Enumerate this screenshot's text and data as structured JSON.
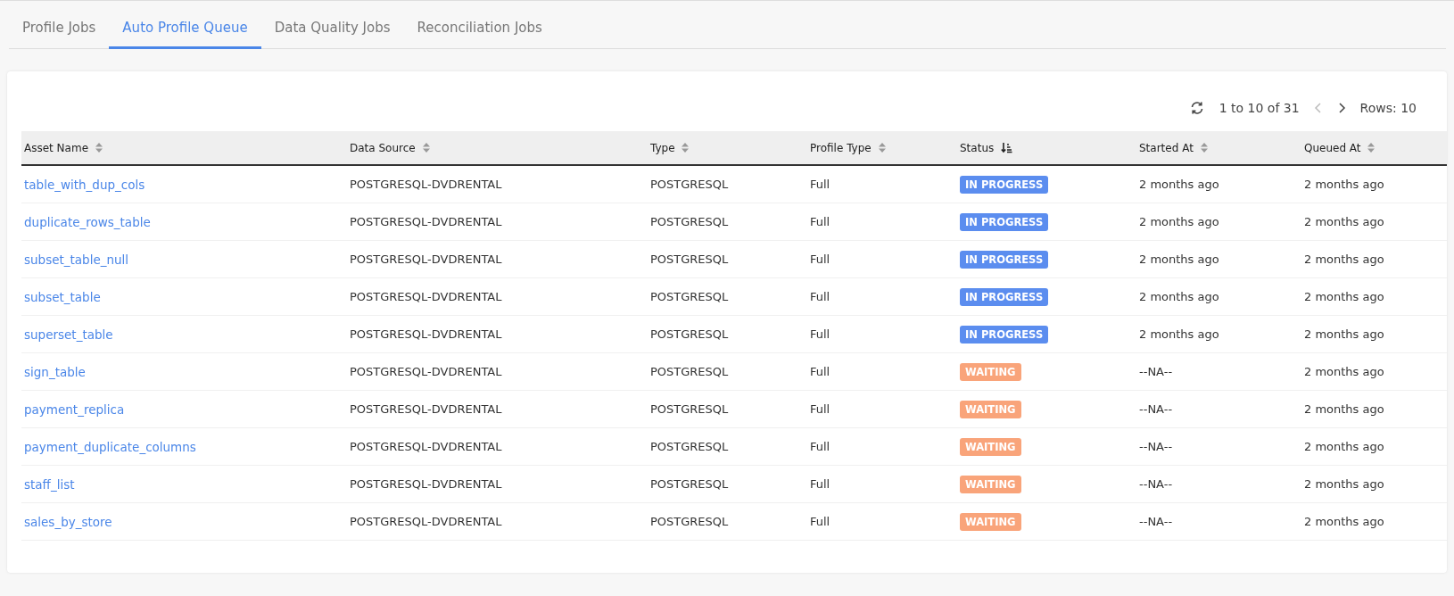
{
  "tabs": [
    {
      "label": "Profile Jobs",
      "selected": false
    },
    {
      "label": "Auto Profile Queue",
      "selected": true
    },
    {
      "label": "Data Quality Jobs",
      "selected": false
    },
    {
      "label": "Reconciliation Jobs",
      "selected": false
    }
  ],
  "pagination": {
    "range": "1 to 10 of 31",
    "rows": "Rows: 10"
  },
  "table": {
    "columns": [
      {
        "label": "Asset Name",
        "sorted": false
      },
      {
        "label": "Data Source",
        "sorted": false
      },
      {
        "label": "Type",
        "sorted": false
      },
      {
        "label": "Profile Type",
        "sorted": false
      },
      {
        "label": "Status",
        "sorted": true
      },
      {
        "label": "Started At",
        "sorted": false
      },
      {
        "label": "Queued At",
        "sorted": false
      }
    ],
    "rows": [
      {
        "asset": "table_with_dup_cols",
        "source": "POSTGRESQL-DVDRENTAL",
        "type": "POSTGRESQL",
        "profile_type": "Full",
        "status": {
          "label": "IN PROGRESS",
          "kind": "progress"
        },
        "started": "2 months ago",
        "queued": "2 months ago"
      },
      {
        "asset": "duplicate_rows_table",
        "source": "POSTGRESQL-DVDRENTAL",
        "type": "POSTGRESQL",
        "profile_type": "Full",
        "status": {
          "label": "IN PROGRESS",
          "kind": "progress"
        },
        "started": "2 months ago",
        "queued": "2 months ago"
      },
      {
        "asset": "subset_table_null",
        "source": "POSTGRESQL-DVDRENTAL",
        "type": "POSTGRESQL",
        "profile_type": "Full",
        "status": {
          "label": "IN PROGRESS",
          "kind": "progress"
        },
        "started": "2 months ago",
        "queued": "2 months ago"
      },
      {
        "asset": "subset_table",
        "source": "POSTGRESQL-DVDRENTAL",
        "type": "POSTGRESQL",
        "profile_type": "Full",
        "status": {
          "label": "IN PROGRESS",
          "kind": "progress"
        },
        "started": "2 months ago",
        "queued": "2 months ago"
      },
      {
        "asset": "superset_table",
        "source": "POSTGRESQL-DVDRENTAL",
        "type": "POSTGRESQL",
        "profile_type": "Full",
        "status": {
          "label": "IN PROGRESS",
          "kind": "progress"
        },
        "started": "2 months ago",
        "queued": "2 months ago"
      },
      {
        "asset": "sign_table",
        "source": "POSTGRESQL-DVDRENTAL",
        "type": "POSTGRESQL",
        "profile_type": "Full",
        "status": {
          "label": "WAITING",
          "kind": "waiting"
        },
        "started": "--NA--",
        "queued": "2 months ago"
      },
      {
        "asset": "payment_replica",
        "source": "POSTGRESQL-DVDRENTAL",
        "type": "POSTGRESQL",
        "profile_type": "Full",
        "status": {
          "label": "WAITING",
          "kind": "waiting"
        },
        "started": "--NA--",
        "queued": "2 months ago"
      },
      {
        "asset": "payment_duplicate_columns",
        "source": "POSTGRESQL-DVDRENTAL",
        "type": "POSTGRESQL",
        "profile_type": "Full",
        "status": {
          "label": "WAITING",
          "kind": "waiting"
        },
        "started": "--NA--",
        "queued": "2 months ago"
      },
      {
        "asset": "staff_list",
        "source": "POSTGRESQL-DVDRENTAL",
        "type": "POSTGRESQL",
        "profile_type": "Full",
        "status": {
          "label": "WAITING",
          "kind": "waiting"
        },
        "started": "--NA--",
        "queued": "2 months ago"
      },
      {
        "asset": "sales_by_store",
        "source": "POSTGRESQL-DVDRENTAL",
        "type": "POSTGRESQL",
        "profile_type": "Full",
        "status": {
          "label": "WAITING",
          "kind": "waiting"
        },
        "started": "--NA--",
        "queued": "2 months ago"
      }
    ]
  }
}
